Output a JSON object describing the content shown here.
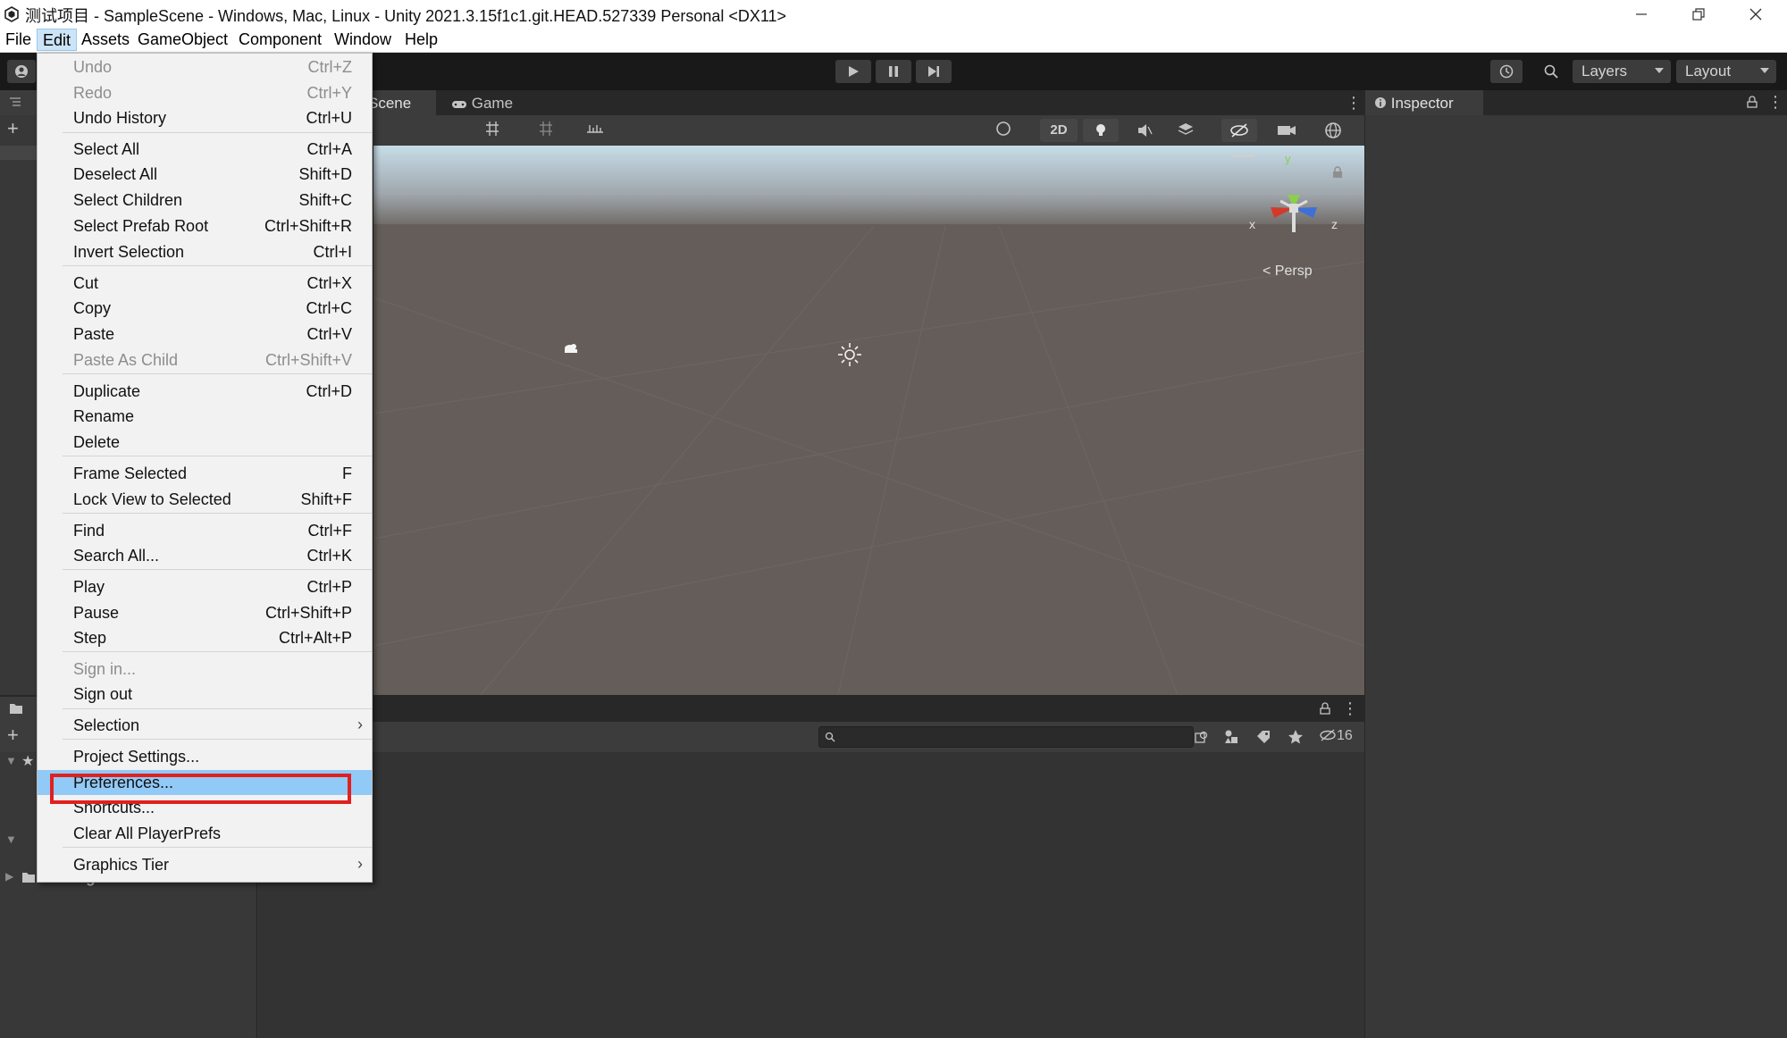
{
  "window": {
    "title": "测试项目 - SampleScene - Windows, Mac, Linux - Unity 2021.3.15f1c1.git.HEAD.527339 Personal <DX11>"
  },
  "menubar": [
    "File",
    "Edit",
    "Assets",
    "GameObject",
    "Component",
    "Window",
    "Help"
  ],
  "toolbar": {
    "layers_label": "Layers",
    "layout_label": "Layout"
  },
  "scene_tabs": {
    "scene": "Scene",
    "game": "Game"
  },
  "scene_toolbar": {
    "mode_2d": "2D"
  },
  "gizmo": {
    "x": "x",
    "y": "y",
    "z": "z",
    "persp": "Persp"
  },
  "inspector": {
    "tab": "Inspector"
  },
  "project": {
    "packages": "Packages",
    "hidden_count": "16"
  },
  "edit_menu": {
    "items": [
      {
        "label": "Undo",
        "shortcut": "Ctrl+Z",
        "disabled": true
      },
      {
        "label": "Redo",
        "shortcut": "Ctrl+Y",
        "disabled": true
      },
      {
        "label": "Undo History",
        "shortcut": "Ctrl+U"
      },
      {
        "label": "Select All",
        "shortcut": "Ctrl+A"
      },
      {
        "label": "Deselect All",
        "shortcut": "Shift+D"
      },
      {
        "label": "Select Children",
        "shortcut": "Shift+C"
      },
      {
        "label": "Select Prefab Root",
        "shortcut": "Ctrl+Shift+R"
      },
      {
        "label": "Invert Selection",
        "shortcut": "Ctrl+I"
      },
      {
        "label": "Cut",
        "shortcut": "Ctrl+X"
      },
      {
        "label": "Copy",
        "shortcut": "Ctrl+C"
      },
      {
        "label": "Paste",
        "shortcut": "Ctrl+V"
      },
      {
        "label": "Paste As Child",
        "shortcut": "Ctrl+Shift+V",
        "disabled": true
      },
      {
        "label": "Duplicate",
        "shortcut": "Ctrl+D"
      },
      {
        "label": "Rename",
        "shortcut": ""
      },
      {
        "label": "Delete",
        "shortcut": ""
      },
      {
        "label": "Frame Selected",
        "shortcut": "F"
      },
      {
        "label": "Lock View to Selected",
        "shortcut": "Shift+F"
      },
      {
        "label": "Find",
        "shortcut": "Ctrl+F"
      },
      {
        "label": "Search All...",
        "shortcut": "Ctrl+K"
      },
      {
        "label": "Play",
        "shortcut": "Ctrl+P"
      },
      {
        "label": "Pause",
        "shortcut": "Ctrl+Shift+P"
      },
      {
        "label": "Step",
        "shortcut": "Ctrl+Alt+P"
      },
      {
        "label": "Sign in...",
        "shortcut": "",
        "disabled": true
      },
      {
        "label": "Sign out",
        "shortcut": ""
      },
      {
        "label": "Selection",
        "shortcut": "",
        "submenu": true
      },
      {
        "label": "Project Settings...",
        "shortcut": ""
      },
      {
        "label": "Preferences...",
        "shortcut": "",
        "highlighted": true
      },
      {
        "label": "Shortcuts...",
        "shortcut": ""
      },
      {
        "label": "Clear All PlayerPrefs",
        "shortcut": ""
      },
      {
        "label": "Graphics Tier",
        "shortcut": "",
        "submenu": true
      }
    ],
    "submenu_glyph": "›"
  },
  "colors": {
    "highlight_bg": "#91c9f7",
    "annotation_box": "#e02020",
    "menu_bg": "#f2f2f2"
  }
}
